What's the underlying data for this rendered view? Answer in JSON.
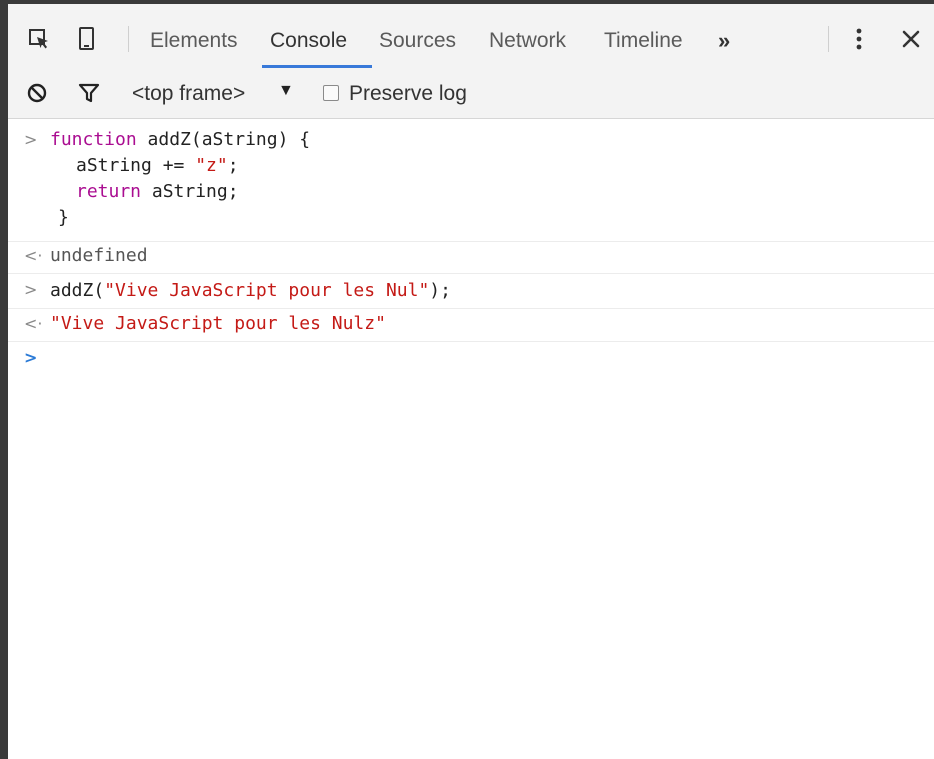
{
  "toolbar": {
    "icons": [
      "inspect-element-icon",
      "device-mode-icon",
      "more-vertical-icon",
      "close-icon"
    ],
    "tabs": [
      {
        "label": "Elements",
        "active": false
      },
      {
        "label": "Console",
        "active": true
      },
      {
        "label": "Sources",
        "active": false
      },
      {
        "label": "Network",
        "active": false
      },
      {
        "label": "Timeline",
        "active": false
      }
    ],
    "more_tabs": "»"
  },
  "console_toolbar": {
    "icons": [
      "clear-console-icon",
      "filter-icon"
    ],
    "frame_select": "<top frame>",
    "preserve_log_label": "Preserve log",
    "preserve_log_checked": false
  },
  "console": {
    "entry1": {
      "line1_kw": "function",
      "line1_rest": " addZ(aString) {",
      "line2_a": "aString += ",
      "line2_str": "\"z\"",
      "line2_b": ";",
      "line3_kw": "return",
      "line3_rest": " aString;",
      "line4": "}"
    },
    "result1": "undefined",
    "entry2": {
      "prefix": "addZ(",
      "str": "\"Vive JavaScript pour les Nul\"",
      "suffix": ");"
    },
    "result2": "\"Vive JavaScript pour les Nulz\"",
    "colors": {
      "keyword": "#aa0d91",
      "string": "#c41a16",
      "active_tab_underline": "#3879d9",
      "prompt": "#2a7ad6"
    }
  }
}
